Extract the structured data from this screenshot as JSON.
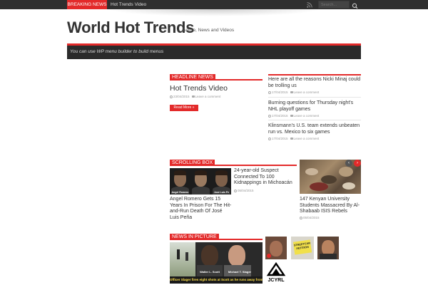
{
  "topbar": {
    "breaking_label": "BREAKING NEWS",
    "breaking_text": "Hot Trends Video",
    "search_placeholder": "Search..."
  },
  "header": {
    "title": "World Hot Trends",
    "description": "Article, News and Videos"
  },
  "nav": {
    "text": "You can use WP menu builder to build menus"
  },
  "headline": {
    "section_label": "HEADLINE NEWS",
    "title": "Hot Trends Video",
    "date": "23/04/2015",
    "comments": "Leave a comment",
    "read_more": "Read More »"
  },
  "side_news": [
    {
      "title": "Here are all the reasons Nicki Minaj could be trolling us",
      "date": "17/04/2015",
      "comments": "Leave a comment"
    },
    {
      "title": "Burning questions for Thursday night's NHL playoff games",
      "date": "17/04/2015",
      "comments": "Leave a comment"
    },
    {
      "title": "Klinsmann's U.S. team extends unbeaten run vs. Mexico to six games",
      "date": "17/04/2015",
      "comments": "Leave a comment"
    }
  ],
  "scrolling": {
    "section_label": "SCROLLING BOX",
    "face_captions": [
      "Angel Romero",
      "",
      "José Luis Pe"
    ],
    "left_title": "Angel Romero Gets 15 Years In Prison For The Hit-and-Run Death Of José Luis Peña",
    "middle_title": "24-year-old Suspect Connected To 100 Kidnappings in Michoacán",
    "middle_date": "05/04/2015",
    "right_title": "147 Kenyan University Students Massacred By Al-Shabaab ISIS Rebels",
    "right_date": "05/04/2015",
    "prev": "‹",
    "next": "›"
  },
  "pictures": {
    "section_label": "NEWS IN PICTURE",
    "caption_walter": "Walter L. Scott",
    "caption_slager": "Michael T. Slager",
    "caption_bottom": "Officer Slager fires eight shots at Scott as he runs away from him.",
    "petition_text": "STREETCAR PETITION",
    "logo_text": "JCYRL"
  },
  "colors": {
    "accent": "#e32a2a",
    "dark": "#2b2b2b"
  }
}
